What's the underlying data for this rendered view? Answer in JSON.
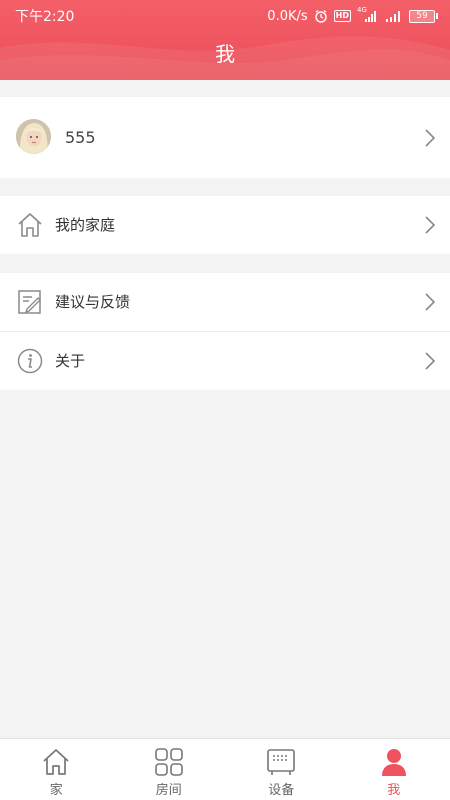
{
  "status_bar": {
    "time": "下午2:20",
    "speed": "0.0K/s",
    "hd": "HD",
    "net": "4G",
    "battery": "59"
  },
  "header": {
    "title": "我"
  },
  "profile": {
    "name": "555"
  },
  "menu": [
    {
      "label": "我的家庭",
      "icon": "home-icon"
    },
    {
      "label": "建议与反馈",
      "icon": "feedback-icon"
    },
    {
      "label": "关于",
      "icon": "info-icon"
    }
  ],
  "tabs": [
    {
      "label": "家",
      "icon": "home-icon",
      "active": false
    },
    {
      "label": "房间",
      "icon": "rooms-grid-icon",
      "active": false
    },
    {
      "label": "设备",
      "icon": "device-icon",
      "active": false
    },
    {
      "label": "我",
      "icon": "person-icon",
      "active": true
    }
  ],
  "colors": {
    "accent": "#ef5360",
    "background": "#f3f3f3",
    "icon_gray": "#8a8a8a"
  }
}
